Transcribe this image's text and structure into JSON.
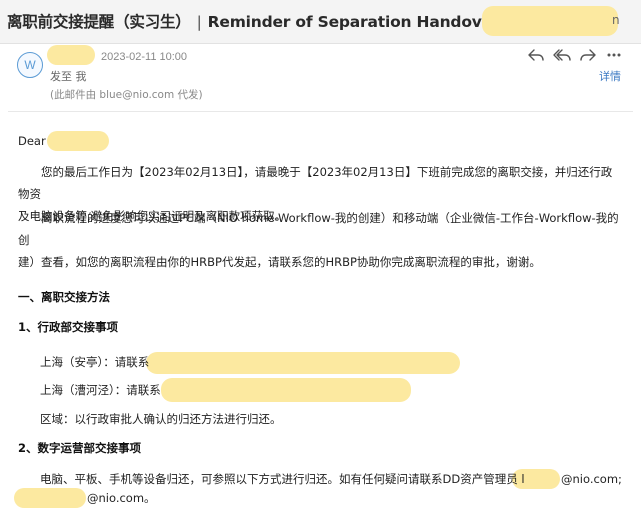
{
  "header": {
    "subject_cn": "离职前交接提醒（实习生）",
    "separator": "|",
    "subject_en": "Reminder of Separation Handover",
    "suffix": "n"
  },
  "meta": {
    "avatar_letter": "W",
    "date": "2023-02-11 10:00",
    "to": "发至 我",
    "sent_on_behalf": "(此邮件由 blue@nio.com 代发)",
    "details_link": "详情"
  },
  "toolbar": {
    "icons": [
      "reply-icon",
      "reply-all-icon",
      "forward-icon",
      "more-icon"
    ]
  },
  "body": {
    "greeting": "Dear",
    "para1_line1": "您的最后工作日为【2023年02月13日】，请最晚于【2023年02月13日】下班前完成您的离职交接，并归还行政物资",
    "para1_line2": "及电脑设备等,避免影响您实习证明及离职款项获取。",
    "para2_line1": "离职流程的进度您可以通过PC端（NIO home-Workflow-我的创建）和移动端（企业微信-工作台-Workflow-我的创",
    "para2_line2": "建）查看，如您的离职流程由你的HRBP代发起，请联系您的HRBP协助你完成离职流程的审批，谢谢。",
    "section1": "一、离职交接方法",
    "sub1": "1、行政部交接事项",
    "shanghai_anting": "上海（安亭）：请联系",
    "shanghai_caohejing": "上海（漕河泾）：请联系",
    "region_note": "区域：以行政审批人确认的归还方法进行归还。",
    "sub2": "2、数字运营部交接事项",
    "devices_line1": "电脑、平板、手机等设备归还，可参照以下方式进行归还。如有任何疑问请联系DD资产管理员 l",
    "devices_email_suffix": "@nio.com;",
    "devices_line2_suffix": "@nio.com。"
  },
  "colors": {
    "highlight": "#fce9a0",
    "link": "#3a78c2",
    "avatar": "#5b9bd5"
  }
}
